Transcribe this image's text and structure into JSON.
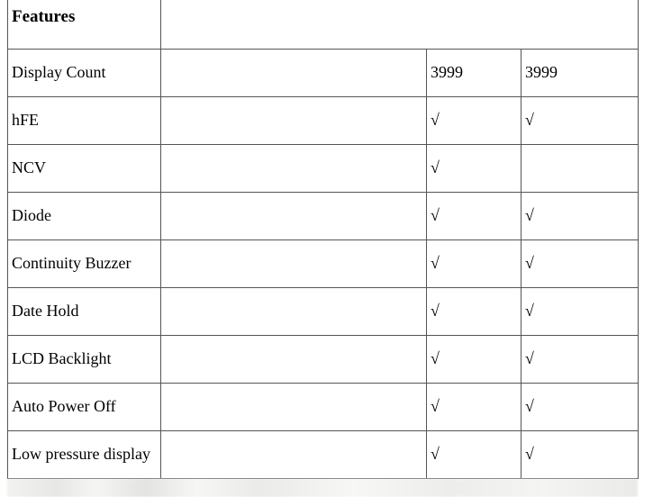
{
  "header": {
    "label": "Features"
  },
  "rows": [
    {
      "label": "Display Count",
      "col2": "",
      "col3": "3999",
      "col4": "3999"
    },
    {
      "label": "hFE",
      "col2": "",
      "col3": "√",
      "col4": "√"
    },
    {
      "label": "NCV",
      "col2": "",
      "col3": "√",
      "col4": ""
    },
    {
      "label": "Diode",
      "col2": "",
      "col3": "√",
      "col4": "√"
    },
    {
      "label": "Continuity Buzzer",
      "col2": "",
      "col3": "√",
      "col4": "√"
    },
    {
      "label": "Date Hold",
      "col2": "",
      "col3": "√",
      "col4": "√"
    },
    {
      "label": "LCD Backlight",
      "col2": "",
      "col3": "√",
      "col4": "√"
    },
    {
      "label": "Auto Power Off",
      "col2": "",
      "col3": "√",
      "col4": "√"
    },
    {
      "label": "Low pressure display",
      "col2": "",
      "col3": "√",
      "col4": "√"
    }
  ]
}
